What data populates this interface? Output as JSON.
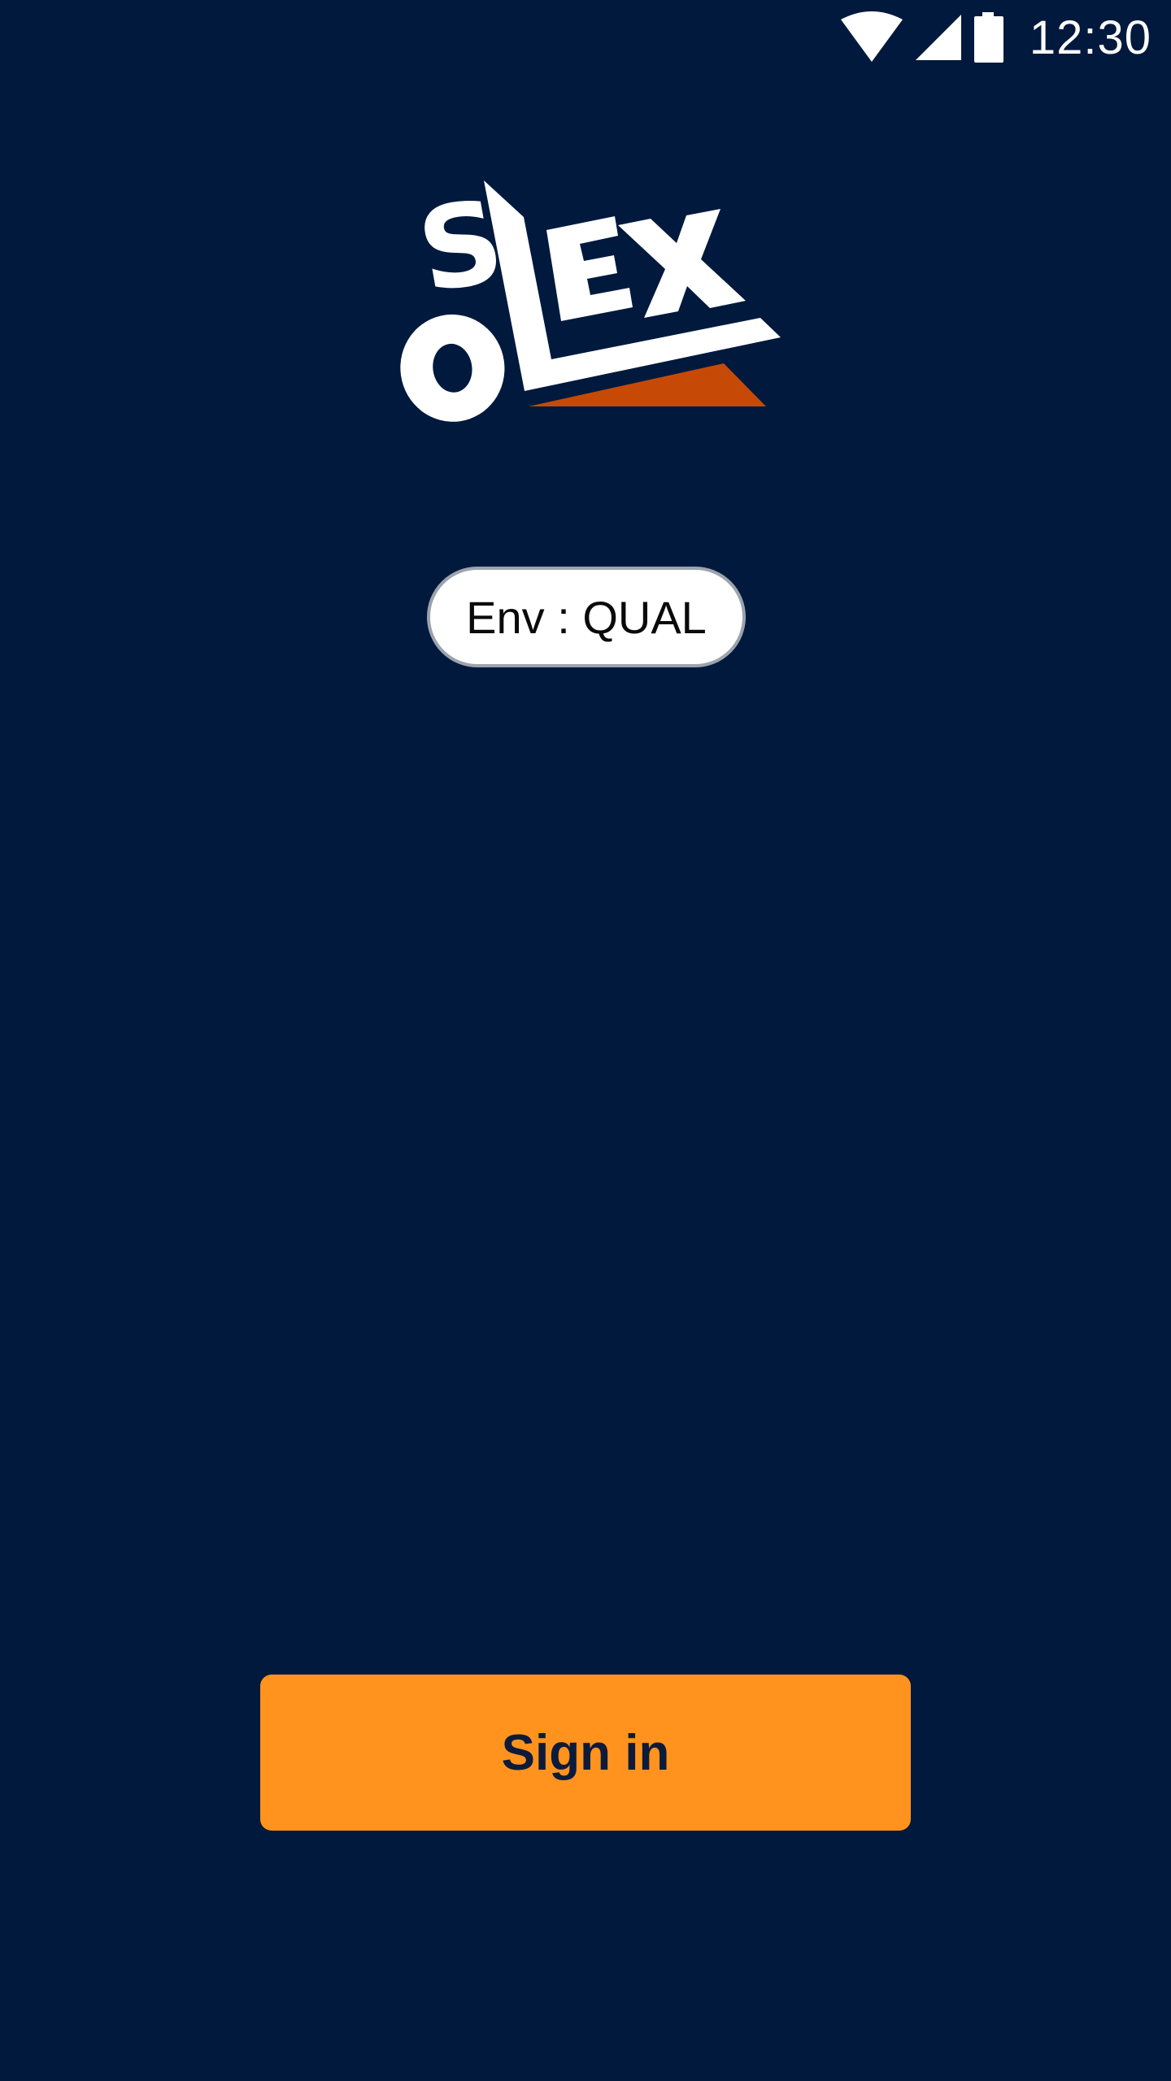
{
  "status_bar": {
    "time": "12:30",
    "icons": [
      "wifi-icon",
      "cellular-signal-icon",
      "battery-icon"
    ]
  },
  "logo": {
    "text": "SOLEX",
    "colors": {
      "letters": "#FFFFFF",
      "accent": "#C64A06"
    }
  },
  "environment": {
    "label": "Env : QUAL"
  },
  "sign_in": {
    "label": "Sign in"
  },
  "colors": {
    "background": "#00193D",
    "primary_button": "#FF931E",
    "button_text": "#0D1B3A"
  }
}
